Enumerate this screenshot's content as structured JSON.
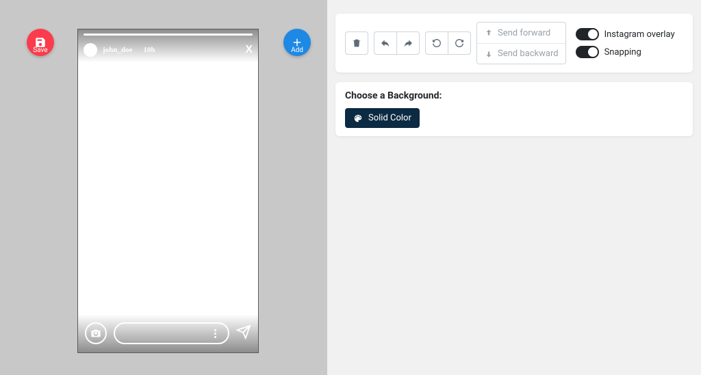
{
  "left": {
    "save_label": "Save",
    "add_label": "Add",
    "story": {
      "username": "john_doe",
      "time": "10h",
      "close": "X"
    }
  },
  "toolbar": {
    "send_forward": "Send forward",
    "send_backward": "Send backward",
    "toggles": {
      "overlay": "Instagram overlay",
      "snapping": "Snapping"
    }
  },
  "background": {
    "heading": "Choose a Background:",
    "solid_color": "Solid Color"
  }
}
